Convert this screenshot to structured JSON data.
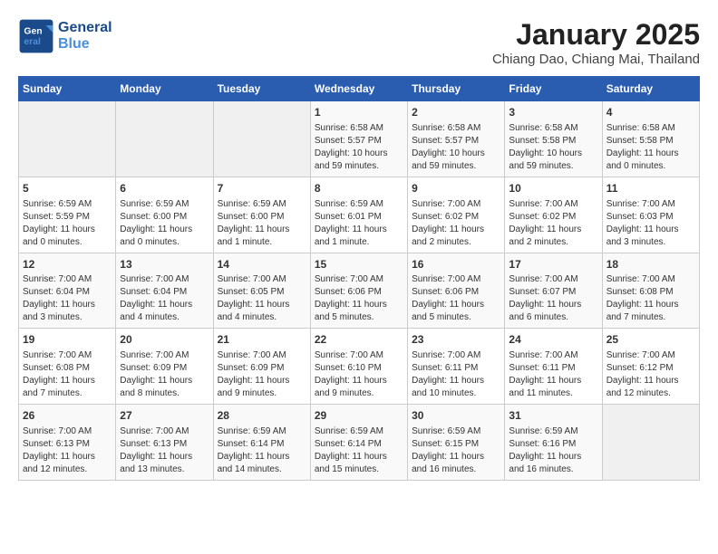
{
  "header": {
    "logo_line1": "General",
    "logo_line2": "Blue",
    "title": "January 2025",
    "subtitle": "Chiang Dao, Chiang Mai, Thailand"
  },
  "weekdays": [
    "Sunday",
    "Monday",
    "Tuesday",
    "Wednesday",
    "Thursday",
    "Friday",
    "Saturday"
  ],
  "weeks": [
    [
      {
        "day": "",
        "empty": true
      },
      {
        "day": "",
        "empty": true
      },
      {
        "day": "",
        "empty": true
      },
      {
        "day": "1",
        "sunrise": "6:58 AM",
        "sunset": "5:57 PM",
        "daylight": "10 hours and 59 minutes."
      },
      {
        "day": "2",
        "sunrise": "6:58 AM",
        "sunset": "5:57 PM",
        "daylight": "10 hours and 59 minutes."
      },
      {
        "day": "3",
        "sunrise": "6:58 AM",
        "sunset": "5:58 PM",
        "daylight": "10 hours and 59 minutes."
      },
      {
        "day": "4",
        "sunrise": "6:58 AM",
        "sunset": "5:58 PM",
        "daylight": "11 hours and 0 minutes."
      }
    ],
    [
      {
        "day": "5",
        "sunrise": "6:59 AM",
        "sunset": "5:59 PM",
        "daylight": "11 hours and 0 minutes."
      },
      {
        "day": "6",
        "sunrise": "6:59 AM",
        "sunset": "6:00 PM",
        "daylight": "11 hours and 0 minutes."
      },
      {
        "day": "7",
        "sunrise": "6:59 AM",
        "sunset": "6:00 PM",
        "daylight": "11 hours and 1 minute."
      },
      {
        "day": "8",
        "sunrise": "6:59 AM",
        "sunset": "6:01 PM",
        "daylight": "11 hours and 1 minute."
      },
      {
        "day": "9",
        "sunrise": "7:00 AM",
        "sunset": "6:02 PM",
        "daylight": "11 hours and 2 minutes."
      },
      {
        "day": "10",
        "sunrise": "7:00 AM",
        "sunset": "6:02 PM",
        "daylight": "11 hours and 2 minutes."
      },
      {
        "day": "11",
        "sunrise": "7:00 AM",
        "sunset": "6:03 PM",
        "daylight": "11 hours and 3 minutes."
      }
    ],
    [
      {
        "day": "12",
        "sunrise": "7:00 AM",
        "sunset": "6:04 PM",
        "daylight": "11 hours and 3 minutes."
      },
      {
        "day": "13",
        "sunrise": "7:00 AM",
        "sunset": "6:04 PM",
        "daylight": "11 hours and 4 minutes."
      },
      {
        "day": "14",
        "sunrise": "7:00 AM",
        "sunset": "6:05 PM",
        "daylight": "11 hours and 4 minutes."
      },
      {
        "day": "15",
        "sunrise": "7:00 AM",
        "sunset": "6:06 PM",
        "daylight": "11 hours and 5 minutes."
      },
      {
        "day": "16",
        "sunrise": "7:00 AM",
        "sunset": "6:06 PM",
        "daylight": "11 hours and 5 minutes."
      },
      {
        "day": "17",
        "sunrise": "7:00 AM",
        "sunset": "6:07 PM",
        "daylight": "11 hours and 6 minutes."
      },
      {
        "day": "18",
        "sunrise": "7:00 AM",
        "sunset": "6:08 PM",
        "daylight": "11 hours and 7 minutes."
      }
    ],
    [
      {
        "day": "19",
        "sunrise": "7:00 AM",
        "sunset": "6:08 PM",
        "daylight": "11 hours and 7 minutes."
      },
      {
        "day": "20",
        "sunrise": "7:00 AM",
        "sunset": "6:09 PM",
        "daylight": "11 hours and 8 minutes."
      },
      {
        "day": "21",
        "sunrise": "7:00 AM",
        "sunset": "6:09 PM",
        "daylight": "11 hours and 9 minutes."
      },
      {
        "day": "22",
        "sunrise": "7:00 AM",
        "sunset": "6:10 PM",
        "daylight": "11 hours and 9 minutes."
      },
      {
        "day": "23",
        "sunrise": "7:00 AM",
        "sunset": "6:11 PM",
        "daylight": "11 hours and 10 minutes."
      },
      {
        "day": "24",
        "sunrise": "7:00 AM",
        "sunset": "6:11 PM",
        "daylight": "11 hours and 11 minutes."
      },
      {
        "day": "25",
        "sunrise": "7:00 AM",
        "sunset": "6:12 PM",
        "daylight": "11 hours and 12 minutes."
      }
    ],
    [
      {
        "day": "26",
        "sunrise": "7:00 AM",
        "sunset": "6:13 PM",
        "daylight": "11 hours and 12 minutes."
      },
      {
        "day": "27",
        "sunrise": "7:00 AM",
        "sunset": "6:13 PM",
        "daylight": "11 hours and 13 minutes."
      },
      {
        "day": "28",
        "sunrise": "6:59 AM",
        "sunset": "6:14 PM",
        "daylight": "11 hours and 14 minutes."
      },
      {
        "day": "29",
        "sunrise": "6:59 AM",
        "sunset": "6:14 PM",
        "daylight": "11 hours and 15 minutes."
      },
      {
        "day": "30",
        "sunrise": "6:59 AM",
        "sunset": "6:15 PM",
        "daylight": "11 hours and 16 minutes."
      },
      {
        "day": "31",
        "sunrise": "6:59 AM",
        "sunset": "6:16 PM",
        "daylight": "11 hours and 16 minutes."
      },
      {
        "day": "",
        "empty": true
      }
    ]
  ]
}
